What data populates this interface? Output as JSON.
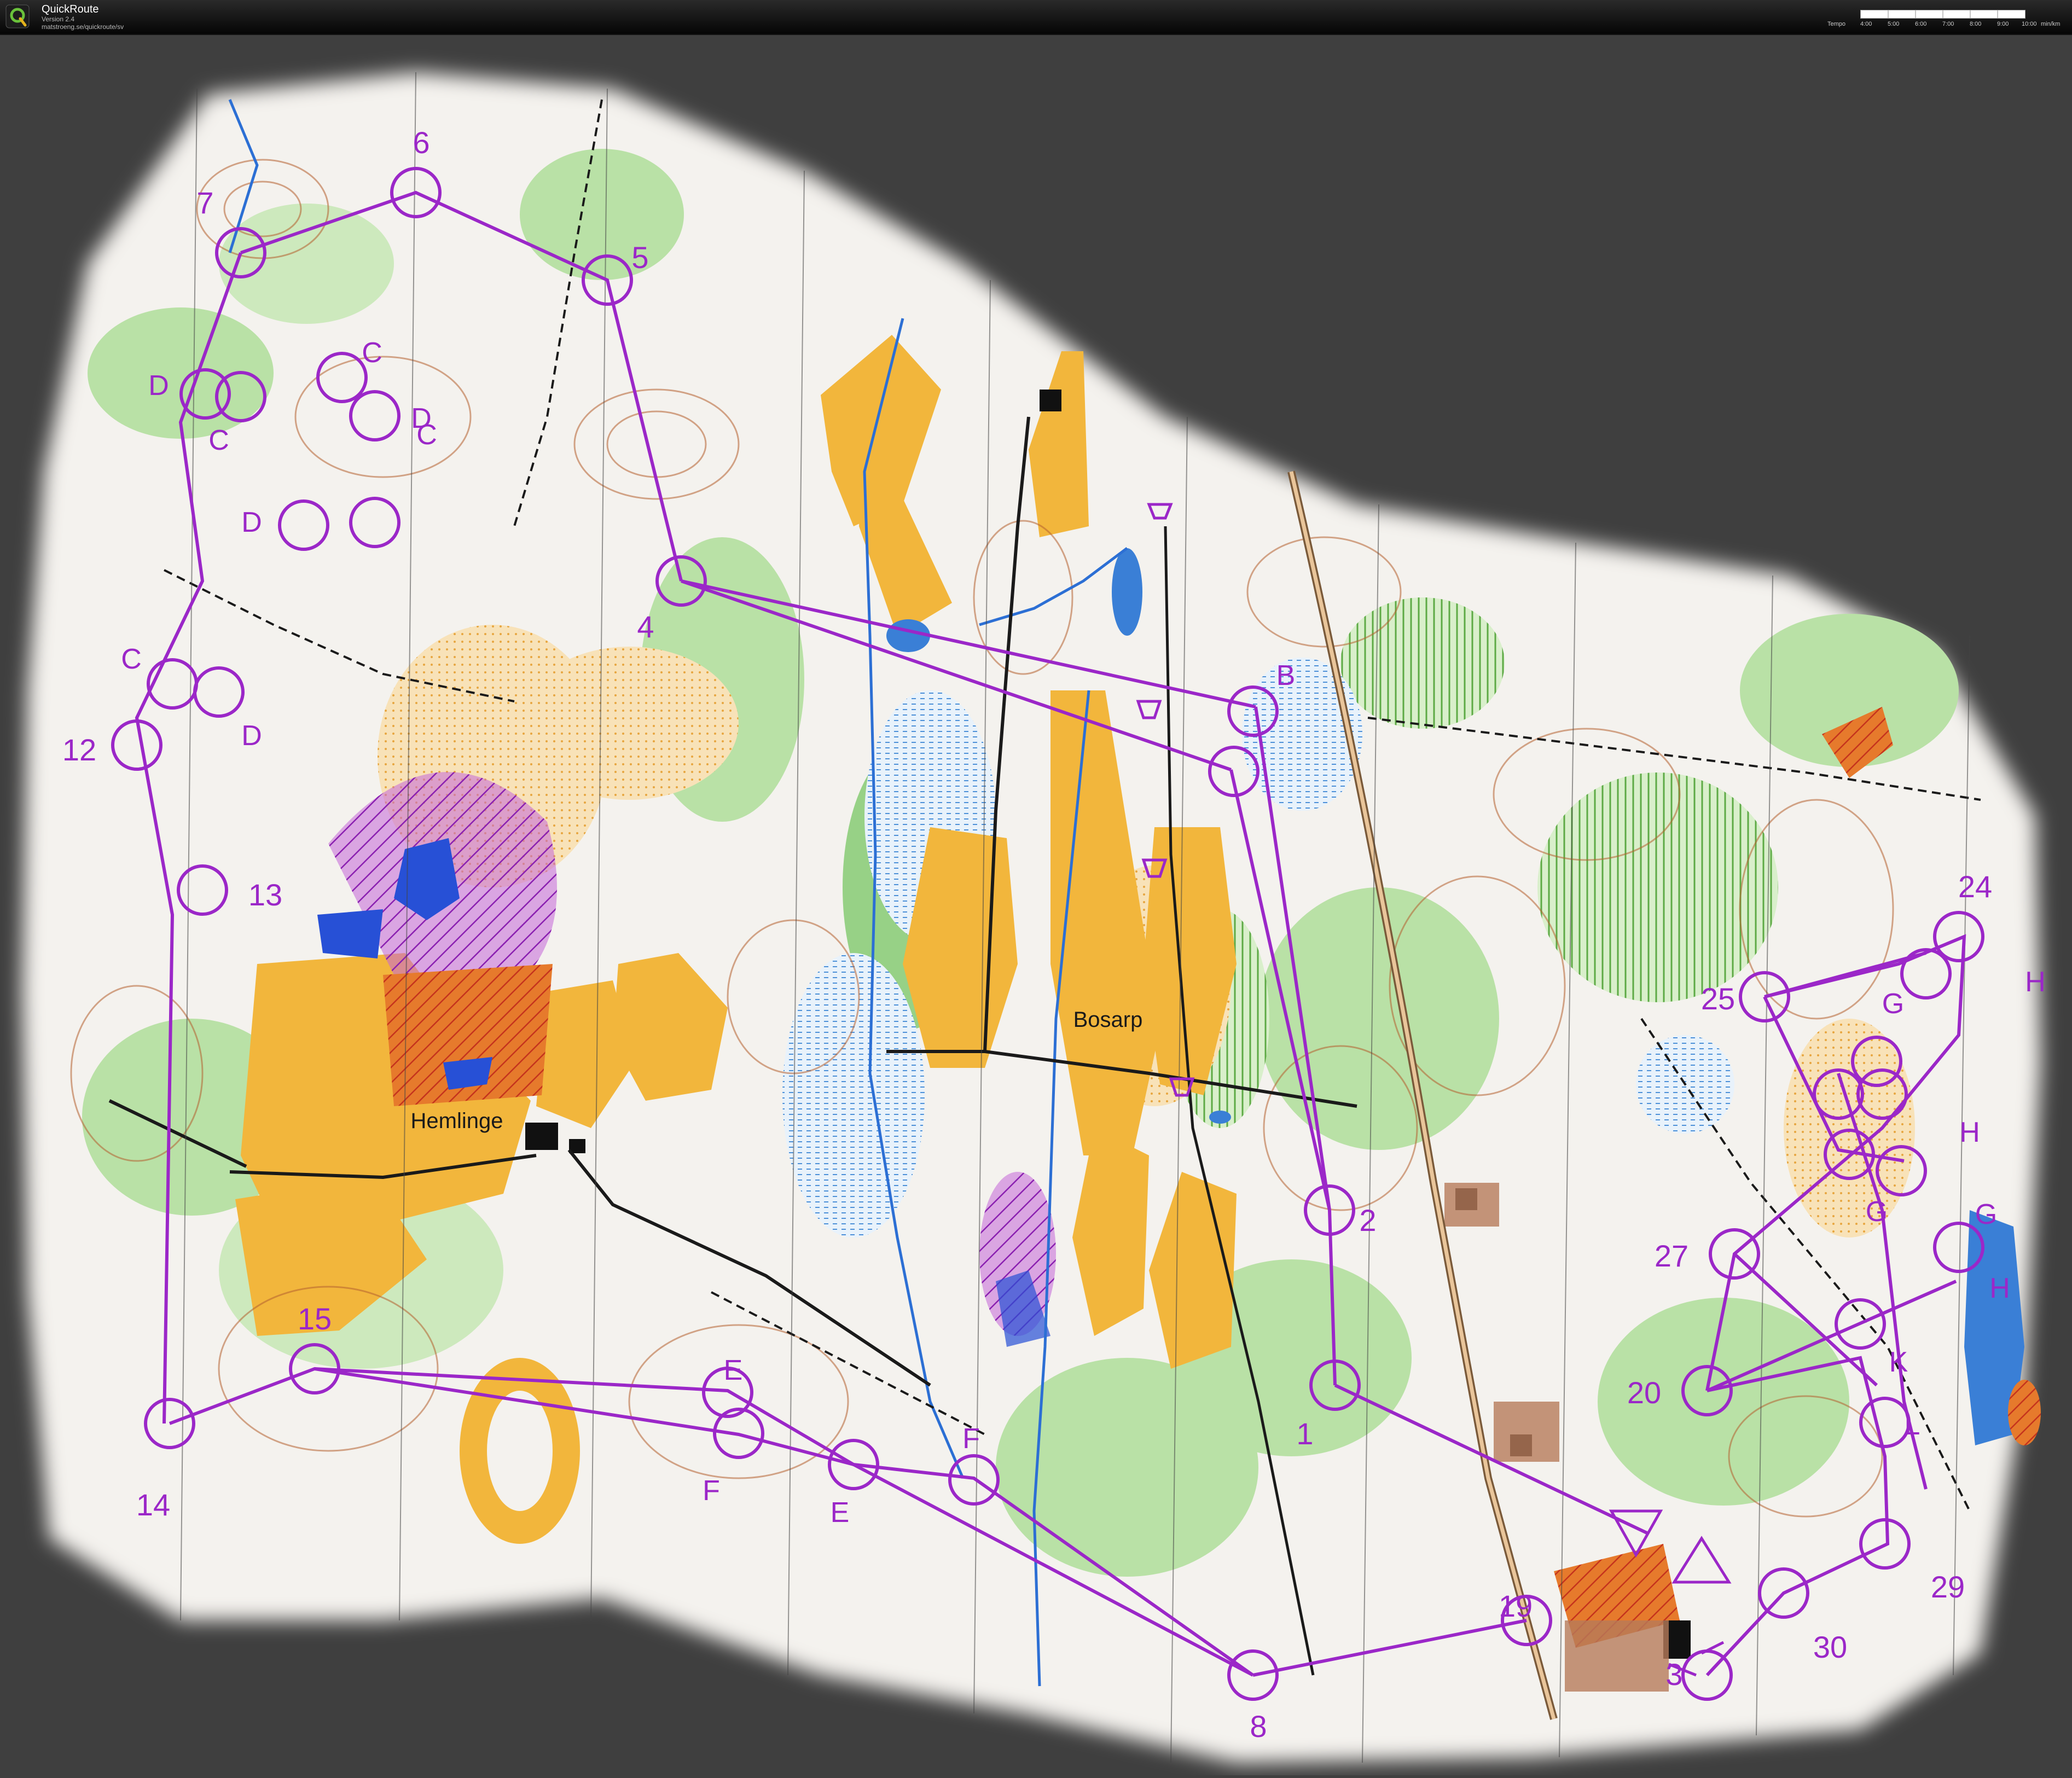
{
  "window": {
    "app_name": "QuickRoute",
    "version": "Version 2.4",
    "url": "matstroeng.se/quickroute/sv",
    "tempo": {
      "label": "Tempo",
      "ticks": [
        "4:00",
        "5:00",
        "6:00",
        "7:00",
        "8:00",
        "9:00",
        "10:00"
      ],
      "unit": "min/km"
    }
  },
  "map": {
    "place_names": [
      "Bosarp",
      "Hemlinge"
    ],
    "colors": {
      "background": "#3f3f3f",
      "paper": "#f4f2ee",
      "forest_green": "#7fc86b",
      "light_green": "#b9e1a6",
      "open_land": "#f2b63c",
      "rough_open": "#f6d89a",
      "water": "#3a7fd6",
      "control_purple": "#9b27c8",
      "contour_brown": "#b5602f",
      "path_black": "#1a1a1a"
    },
    "controls": [
      {
        "label": "1"
      },
      {
        "label": "2"
      },
      {
        "label": "3"
      },
      {
        "label": "4"
      },
      {
        "label": "5"
      },
      {
        "label": "6"
      },
      {
        "label": "7"
      },
      {
        "label": "8"
      },
      {
        "label": "12"
      },
      {
        "label": "13"
      },
      {
        "label": "14"
      },
      {
        "label": "15"
      },
      {
        "label": "19"
      },
      {
        "label": "20"
      },
      {
        "label": "24"
      },
      {
        "label": "25"
      },
      {
        "label": "27"
      },
      {
        "label": "29"
      },
      {
        "label": "30"
      }
    ],
    "fork_labels": [
      "B",
      "C",
      "C",
      "C",
      "C",
      "D",
      "D",
      "D",
      "D",
      "E",
      "E",
      "F",
      "F",
      "G",
      "G",
      "G",
      "H",
      "H",
      "H",
      "K",
      "L"
    ]
  }
}
